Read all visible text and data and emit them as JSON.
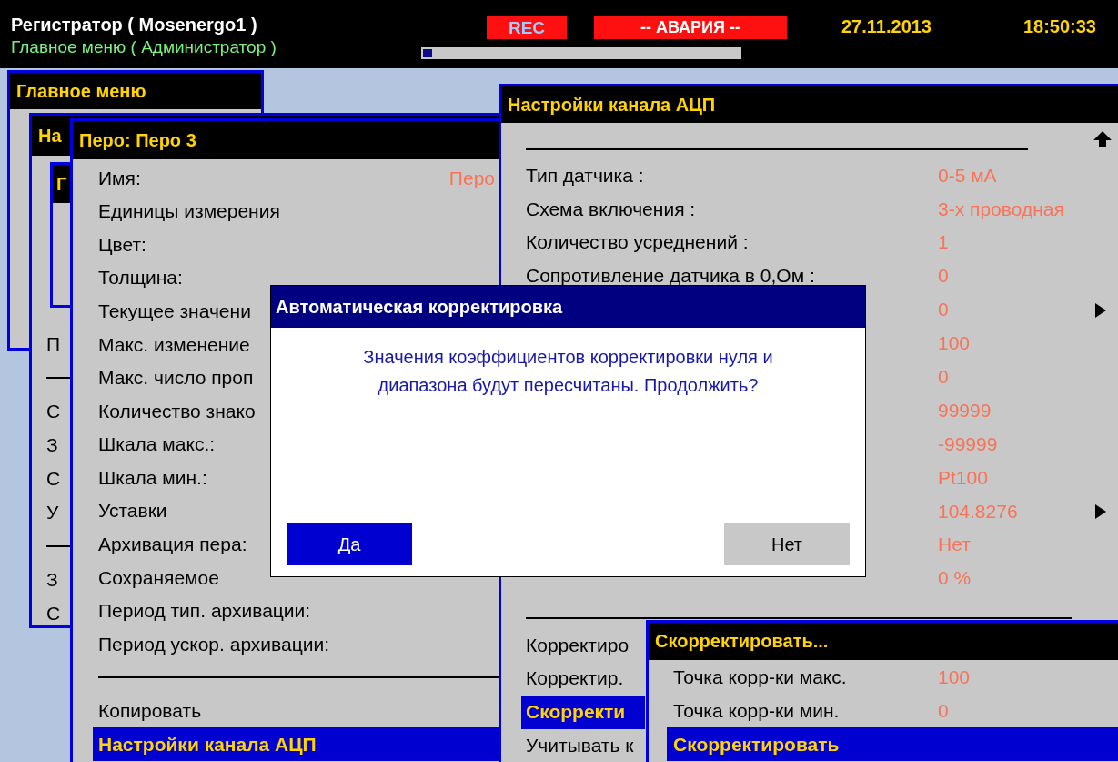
{
  "header": {
    "title": "Регистратор ( Mosenergo1 )",
    "subtitle": "Главное меню ( Администратор )",
    "rec": "REC",
    "alarm": "-- АВАРИЯ --",
    "date": "27.11.2013",
    "time": "18:50:33",
    "progress": {
      "level": 0.03
    }
  },
  "main_menu": {
    "title": "Главное меню"
  },
  "settings_window": {
    "title": "На",
    "inner_title": "Г",
    "items": [
      {
        "kind": "item",
        "label": "П"
      },
      {
        "kind": "divider"
      },
      {
        "kind": "item",
        "label": "С"
      },
      {
        "kind": "item",
        "label": "З"
      },
      {
        "kind": "item",
        "label": "С"
      },
      {
        "kind": "item",
        "label": "У"
      },
      {
        "kind": "divider"
      },
      {
        "kind": "item",
        "label": "З"
      },
      {
        "kind": "item",
        "label": "С"
      }
    ]
  },
  "pen_window": {
    "title": "Перо: Перо 3",
    "items": [
      {
        "kind": "item",
        "label": "Имя:",
        "value": "Перо",
        "selected": false
      },
      {
        "kind": "item",
        "label": "Единицы измерения",
        "selected": false
      },
      {
        "kind": "item",
        "label": "Цвет:",
        "selected": false
      },
      {
        "kind": "item",
        "label": "Толщина:",
        "selected": false
      },
      {
        "kind": "item",
        "label": "Текущее значени",
        "selected": false
      },
      {
        "kind": "item",
        "label": "Макс. изменение",
        "selected": false
      },
      {
        "kind": "item",
        "label": "Макс. число проп",
        "selected": false
      },
      {
        "kind": "item",
        "label": "Количество знако",
        "selected": false
      },
      {
        "kind": "item",
        "label": "Шкала макс.:",
        "selected": false
      },
      {
        "kind": "item",
        "label": "Шкала мин.:",
        "selected": false
      },
      {
        "kind": "item",
        "label": "Уставки",
        "selected": false
      },
      {
        "kind": "item",
        "label": "Архивация пера:",
        "selected": false
      },
      {
        "kind": "item",
        "label": "Сохраняемое",
        "selected": false
      },
      {
        "kind": "item",
        "label": "Период тип. архивации:",
        "selected": false
      },
      {
        "kind": "item",
        "label": "Период ускор. архивации:",
        "selected": false
      },
      {
        "kind": "divider"
      },
      {
        "kind": "item",
        "label": "Копировать",
        "selected": false
      },
      {
        "kind": "item",
        "label": "Настройки канала АЦП",
        "selected": true
      }
    ]
  },
  "adc_window": {
    "title": "Настройки канала АЦП",
    "items": [
      {
        "kind": "divider"
      },
      {
        "kind": "row",
        "label": "Тип датчика :",
        "value": "0-5 мА",
        "submenu": false
      },
      {
        "kind": "row",
        "label": "Схема включения :",
        "value": "3-х проводная",
        "submenu": false
      },
      {
        "kind": "row",
        "label": "Количество усреднений :",
        "value": "1",
        "submenu": false
      },
      {
        "kind": "row",
        "label": "Сопротивление датчика в 0,Ом :",
        "value": "0",
        "submenu": false
      },
      {
        "kind": "row",
        "value": "0",
        "submenu": true
      },
      {
        "kind": "row",
        "value": "100",
        "submenu": false
      },
      {
        "kind": "row",
        "value": "0",
        "submenu": false
      },
      {
        "kind": "row",
        "value": "99999",
        "submenu": false
      },
      {
        "kind": "row",
        "value": "-99999",
        "submenu": false
      },
      {
        "kind": "row",
        "value": "Pt100",
        "submenu": false
      },
      {
        "kind": "row",
        "value": "104.8276",
        "submenu": true
      },
      {
        "kind": "row",
        "value": "Нет",
        "submenu": false
      },
      {
        "kind": "row",
        "value": "0 %",
        "submenu": false
      },
      {
        "kind": "divider"
      },
      {
        "kind": "action",
        "label": "Корректиро",
        "selected": false
      },
      {
        "kind": "action",
        "label": "Корректир.",
        "selected": false
      },
      {
        "kind": "action",
        "label": "Скорректи",
        "selected": true
      },
      {
        "kind": "action",
        "label": "Учитывать к",
        "selected": false
      }
    ]
  },
  "correct_window": {
    "title": "Скорректировать...",
    "items": [
      {
        "kind": "row",
        "label": "Точка корр-ки макс.",
        "value": "100"
      },
      {
        "kind": "row",
        "label": "Точка корр-ки мин.",
        "value": "0"
      },
      {
        "kind": "action",
        "label": "Скорректировать",
        "selected": true
      }
    ]
  },
  "dialog": {
    "title": "Автоматическая корректировка",
    "message": "Значения коэффициентов корректировки нуля и диапазона будут пересчитаны. Продолжить?",
    "buttons": [
      {
        "label": "Да",
        "selected": true
      },
      {
        "label": "Нет",
        "selected": false
      }
    ]
  }
}
